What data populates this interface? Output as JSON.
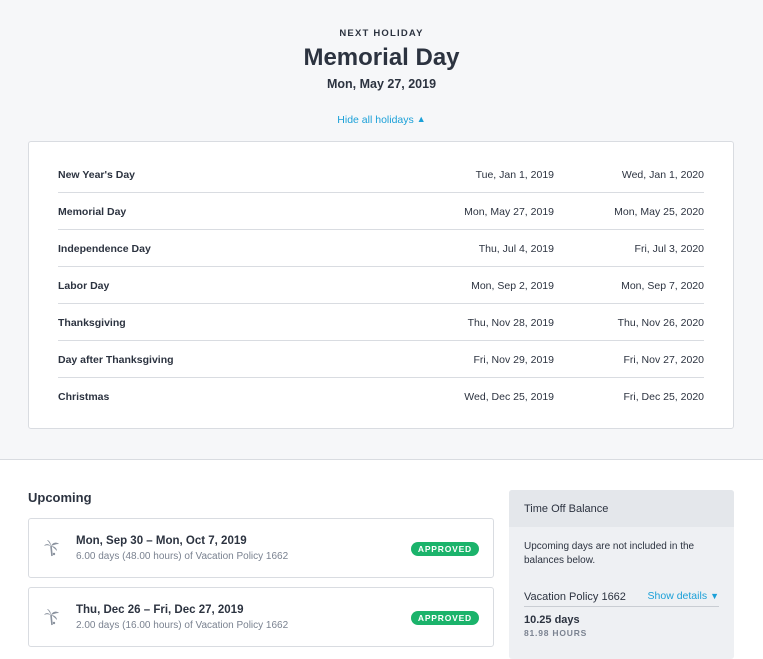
{
  "next_holiday": {
    "eyebrow": "NEXT HOLIDAY",
    "name": "Memorial Day",
    "date": "Mon, May 27, 2019",
    "toggle_label": "Hide all holidays",
    "toggle_icon": "chevron-up-icon"
  },
  "holidays": [
    {
      "name": "New Year's Day",
      "date_2019": "Tue, Jan 1, 2019",
      "date_2020": "Wed, Jan 1, 2020"
    },
    {
      "name": "Memorial Day",
      "date_2019": "Mon, May 27, 2019",
      "date_2020": "Mon, May 25, 2020"
    },
    {
      "name": "Independence Day",
      "date_2019": "Thu, Jul 4, 2019",
      "date_2020": "Fri, Jul 3, 2020"
    },
    {
      "name": "Labor Day",
      "date_2019": "Mon, Sep 2, 2019",
      "date_2020": "Mon, Sep 7, 2020"
    },
    {
      "name": "Thanksgiving",
      "date_2019": "Thu, Nov 28, 2019",
      "date_2020": "Thu, Nov 26, 2020"
    },
    {
      "name": "Day after Thanksgiving",
      "date_2019": "Fri, Nov 29, 2019",
      "date_2020": "Fri, Nov 27, 2020"
    },
    {
      "name": "Christmas",
      "date_2019": "Wed, Dec 25, 2019",
      "date_2020": "Fri, Dec 25, 2020"
    }
  ],
  "upcoming": {
    "title": "Upcoming",
    "requests": [
      {
        "dates": "Mon, Sep 30 – Mon, Oct 7, 2019",
        "detail": "6.00 days (48.00 hours) of Vacation Policy 1662",
        "status": "APPROVED",
        "icon": "palm-tree-icon"
      },
      {
        "dates": "Thu, Dec 26 – Fri, Dec 27, 2019",
        "detail": "2.00 days (16.00 hours) of Vacation Policy 1662",
        "status": "APPROVED",
        "icon": "palm-tree-icon"
      }
    ]
  },
  "balance": {
    "title": "Time Off Balance",
    "note": "Upcoming days are not included in the balances below.",
    "policy_name": "Vacation Policy 1662",
    "show_details_label": "Show details",
    "days": "10.25 days",
    "hours": "81.98 HOURS"
  },
  "colors": {
    "accent": "#1ba0d8",
    "approved": "#1bb36b",
    "text": "#2c3340",
    "muted": "#7a8290"
  }
}
